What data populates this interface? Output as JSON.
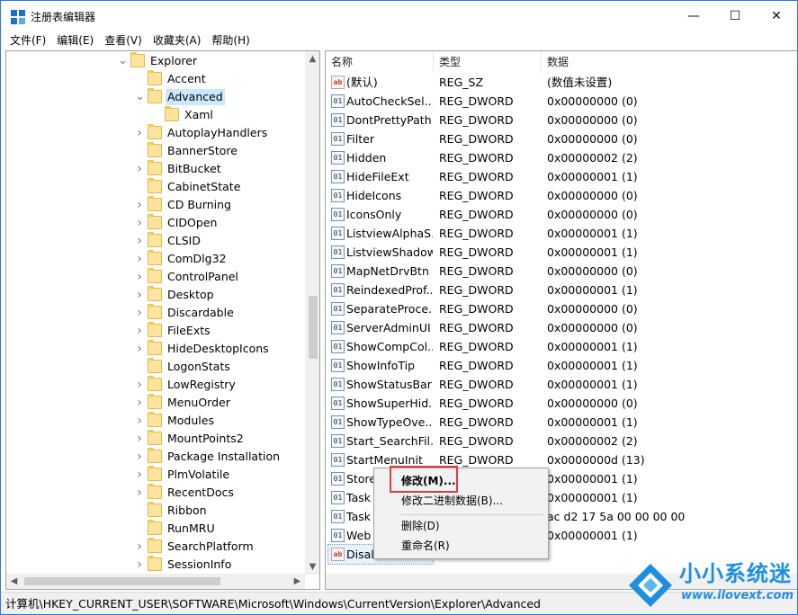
{
  "window": {
    "title": "注册表编辑器",
    "controls": {
      "minimize": "—",
      "maximize": "☐",
      "close": "✕"
    }
  },
  "menubar": {
    "items": [
      "文件(F)",
      "编辑(E)",
      "查看(V)",
      "收藏夹(A)",
      "帮助(H)"
    ]
  },
  "tree": {
    "items": [
      {
        "label": "Explorer",
        "level": 0,
        "state": "expanded"
      },
      {
        "label": "Accent",
        "level": 1,
        "state": "leaf"
      },
      {
        "label": "Advanced",
        "level": 1,
        "state": "expanded",
        "selected": true
      },
      {
        "label": "Xaml",
        "level": 2,
        "state": "leaf"
      },
      {
        "label": "AutoplayHandlers",
        "level": 1,
        "state": "collapsed"
      },
      {
        "label": "BannerStore",
        "level": 1,
        "state": "leaf"
      },
      {
        "label": "BitBucket",
        "level": 1,
        "state": "collapsed"
      },
      {
        "label": "CabinetState",
        "level": 1,
        "state": "leaf"
      },
      {
        "label": "CD Burning",
        "level": 1,
        "state": "collapsed"
      },
      {
        "label": "CIDOpen",
        "level": 1,
        "state": "collapsed"
      },
      {
        "label": "CLSID",
        "level": 1,
        "state": "collapsed"
      },
      {
        "label": "ComDlg32",
        "level": 1,
        "state": "collapsed"
      },
      {
        "label": "ControlPanel",
        "level": 1,
        "state": "collapsed"
      },
      {
        "label": "Desktop",
        "level": 1,
        "state": "collapsed"
      },
      {
        "label": "Discardable",
        "level": 1,
        "state": "collapsed"
      },
      {
        "label": "FileExts",
        "level": 1,
        "state": "collapsed"
      },
      {
        "label": "HideDesktopIcons",
        "level": 1,
        "state": "collapsed"
      },
      {
        "label": "LogonStats",
        "level": 1,
        "state": "leaf"
      },
      {
        "label": "LowRegistry",
        "level": 1,
        "state": "collapsed"
      },
      {
        "label": "MenuOrder",
        "level": 1,
        "state": "collapsed"
      },
      {
        "label": "Modules",
        "level": 1,
        "state": "collapsed"
      },
      {
        "label": "MountPoints2",
        "level": 1,
        "state": "collapsed"
      },
      {
        "label": "Package Installation",
        "level": 1,
        "state": "collapsed"
      },
      {
        "label": "PlmVolatile",
        "level": 1,
        "state": "collapsed"
      },
      {
        "label": "RecentDocs",
        "level": 1,
        "state": "collapsed"
      },
      {
        "label": "Ribbon",
        "level": 1,
        "state": "leaf"
      },
      {
        "label": "RunMRU",
        "level": 1,
        "state": "leaf"
      },
      {
        "label": "SearchPlatform",
        "level": 1,
        "state": "collapsed"
      },
      {
        "label": "SessionInfo",
        "level": 1,
        "state": "collapsed"
      }
    ]
  },
  "list": {
    "headers": {
      "name": "名称",
      "type": "类型",
      "data": "数据"
    },
    "rows": [
      {
        "name": "(默认)",
        "type": "REG_SZ",
        "data": "(数值未设置)",
        "icon": "sz"
      },
      {
        "name": "AutoCheckSel...",
        "type": "REG_DWORD",
        "data": "0x00000000 (0)",
        "icon": "dword"
      },
      {
        "name": "DontPrettyPath",
        "type": "REG_DWORD",
        "data": "0x00000000 (0)",
        "icon": "dword"
      },
      {
        "name": "Filter",
        "type": "REG_DWORD",
        "data": "0x00000000 (0)",
        "icon": "dword"
      },
      {
        "name": "Hidden",
        "type": "REG_DWORD",
        "data": "0x00000002 (2)",
        "icon": "dword"
      },
      {
        "name": "HideFileExt",
        "type": "REG_DWORD",
        "data": "0x00000001 (1)",
        "icon": "dword"
      },
      {
        "name": "HideIcons",
        "type": "REG_DWORD",
        "data": "0x00000000 (0)",
        "icon": "dword"
      },
      {
        "name": "IconsOnly",
        "type": "REG_DWORD",
        "data": "0x00000000 (0)",
        "icon": "dword"
      },
      {
        "name": "ListviewAlphaS...",
        "type": "REG_DWORD",
        "data": "0x00000001 (1)",
        "icon": "dword"
      },
      {
        "name": "ListviewShadow",
        "type": "REG_DWORD",
        "data": "0x00000001 (1)",
        "icon": "dword"
      },
      {
        "name": "MapNetDrvBtn",
        "type": "REG_DWORD",
        "data": "0x00000000 (0)",
        "icon": "dword"
      },
      {
        "name": "ReindexedProf...",
        "type": "REG_DWORD",
        "data": "0x00000001 (1)",
        "icon": "dword"
      },
      {
        "name": "SeparateProce...",
        "type": "REG_DWORD",
        "data": "0x00000000 (0)",
        "icon": "dword"
      },
      {
        "name": "ServerAdminUI",
        "type": "REG_DWORD",
        "data": "0x00000000 (0)",
        "icon": "dword"
      },
      {
        "name": "ShowCompCol...",
        "type": "REG_DWORD",
        "data": "0x00000001 (1)",
        "icon": "dword"
      },
      {
        "name": "ShowInfoTip",
        "type": "REG_DWORD",
        "data": "0x00000001 (1)",
        "icon": "dword"
      },
      {
        "name": "ShowStatusBar",
        "type": "REG_DWORD",
        "data": "0x00000001 (1)",
        "icon": "dword"
      },
      {
        "name": "ShowSuperHid...",
        "type": "REG_DWORD",
        "data": "0x00000000 (0)",
        "icon": "dword"
      },
      {
        "name": "ShowTypeOve...",
        "type": "REG_DWORD",
        "data": "0x00000001 (1)",
        "icon": "dword"
      },
      {
        "name": "Start_SearchFil...",
        "type": "REG_DWORD",
        "data": "0x00000002 (2)",
        "icon": "dword"
      },
      {
        "name": "StartMenuInit",
        "type": "REG_DWORD",
        "data": "0x0000000d (13)",
        "icon": "dword"
      },
      {
        "name": "Store",
        "type": "",
        "data": "0x00000001 (1)",
        "icon": "dword"
      },
      {
        "name": "Task",
        "type": "",
        "data": "0x00000001 (1)",
        "icon": "dword"
      },
      {
        "name": "Task",
        "type": "",
        "data": "ac d2 17 5a 00 00 00 00",
        "icon": "dword"
      },
      {
        "name": "Web",
        "type": "",
        "data": "0x00000001 (1)",
        "icon": "dword"
      },
      {
        "name": "Disal",
        "type": "",
        "data": "",
        "icon": "sz",
        "selected": true
      }
    ]
  },
  "context_menu": {
    "items": [
      {
        "label": "修改(M)...",
        "bold": true
      },
      {
        "label": "修改二进制数据(B)...",
        "bold": false
      },
      {
        "label": "删除(D)",
        "bold": false
      },
      {
        "label": "重命名(R)",
        "bold": false
      }
    ]
  },
  "statusbar": {
    "path": "计算机\\HKEY_CURRENT_USER\\SOFTWARE\\Microsoft\\Windows\\CurrentVersion\\Explorer\\Advanced"
  },
  "watermark": {
    "title": "小小系统迷",
    "url": "www.ilovext.com"
  },
  "colors": {
    "accent": "#2b79d8",
    "selection": "#cce8ff",
    "highlight_box": "#e03c3c",
    "watermark": "#1e8fe0"
  }
}
